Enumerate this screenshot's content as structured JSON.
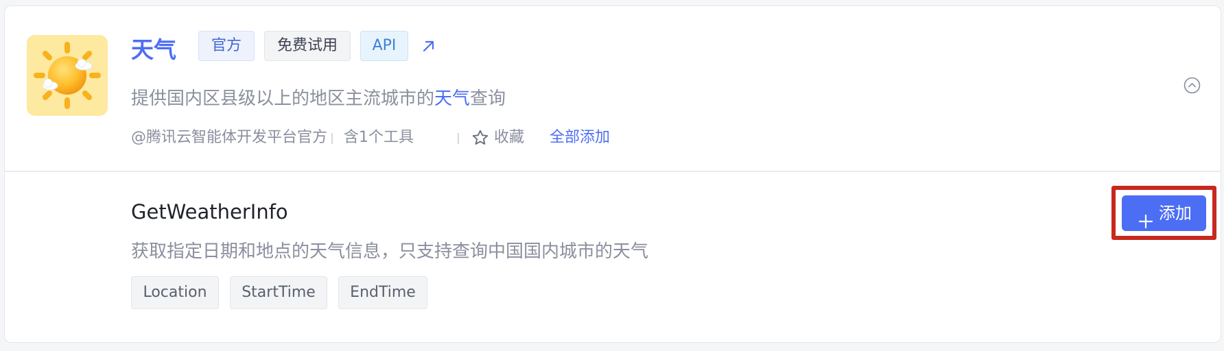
{
  "plugin": {
    "title": "天气",
    "tags": {
      "official": "官方",
      "free_trial": "免费试用",
      "api": "API"
    },
    "description_prefix": "提供国内区县级以上的地区主流城市的",
    "description_highlight": "天气",
    "description_suffix": "查询",
    "author": "@腾讯云智能体开发平台官方",
    "tool_count": "含1个工具",
    "favorite_label": "收藏",
    "add_all_label": "全部添加",
    "logo_icon": "weather-sun-cloud-icon",
    "external_link_icon": "arrow-up-right-icon",
    "collapse_icon": "chevron-up-circle-icon"
  },
  "tool": {
    "name": "GetWeatherInfo",
    "description": "获取指定日期和地点的天气信息，只支持查询中国国内城市的天气",
    "params": [
      "Location",
      "StartTime",
      "EndTime"
    ],
    "add_button_label": "添加",
    "add_button_icon": "plus-icon"
  },
  "colors": {
    "accent": "#4c6ef5",
    "highlight_box": "#c8281e",
    "muted_text": "#8a8f9e"
  }
}
